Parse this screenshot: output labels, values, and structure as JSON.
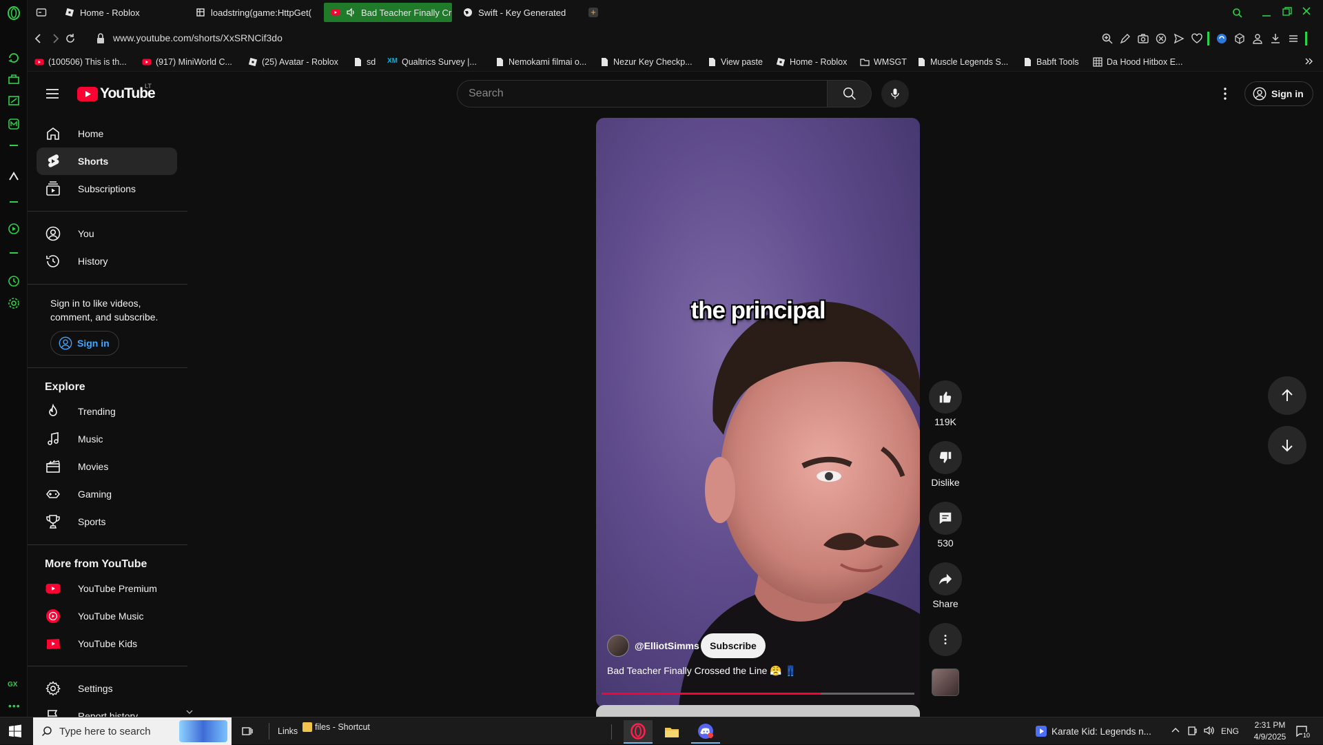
{
  "browser": {
    "tabs": [
      {
        "label": "Home - Roblox",
        "active": false
      },
      {
        "label": "loadstring(game:HttpGet(",
        "active": false
      },
      {
        "label": "Bad Teacher Finally Cr",
        "active": true
      },
      {
        "label": "Swift - Key Generated",
        "active": false
      }
    ],
    "new_tab_symbol": "+",
    "url": "www.youtube.com/shorts/XxSRNCif3do",
    "bookmarks": [
      "(100506) This is th...",
      "(917) MiniWorld C...",
      "(25) Avatar - Roblox",
      "sd",
      "Qualtrics Survey |...",
      "Nemokami filmai o...",
      "Nezur Key Checkp...",
      "View paste",
      "Home - Roblox",
      "WMSGT",
      "Muscle Legends S...",
      "Babft Tools",
      "Da Hood Hitbox E..."
    ],
    "bookmark_qualtrics_badge": "XM",
    "gx_label": "GX",
    "accent_color": "#2bd24a"
  },
  "youtube": {
    "logo_text": "YouTube",
    "country_code": "LT",
    "search_placeholder": "Search",
    "sign_in_label": "Sign in",
    "sidebar": {
      "primary": [
        {
          "label": "Home",
          "icon": "home-icon",
          "active": false
        },
        {
          "label": "Shorts",
          "icon": "shorts-icon",
          "active": true
        },
        {
          "label": "Subscriptions",
          "icon": "subscriptions-icon",
          "active": false
        }
      ],
      "you": [
        {
          "label": "You",
          "icon": "you-icon"
        },
        {
          "label": "History",
          "icon": "history-icon"
        }
      ],
      "signin_prompt": "Sign in to like videos, comment, and subscribe.",
      "explore_heading": "Explore",
      "explore": [
        {
          "label": "Trending",
          "icon": "trending-icon"
        },
        {
          "label": "Music",
          "icon": "music-icon"
        },
        {
          "label": "Movies",
          "icon": "movies-icon"
        },
        {
          "label": "Gaming",
          "icon": "gaming-icon"
        },
        {
          "label": "Sports",
          "icon": "sports-icon"
        }
      ],
      "more_heading": "More from YouTube",
      "more": [
        {
          "label": "YouTube Premium",
          "icon": "youtube-premium-icon"
        },
        {
          "label": "YouTube Music",
          "icon": "youtube-music-icon"
        },
        {
          "label": "YouTube Kids",
          "icon": "youtube-kids-icon"
        }
      ],
      "settings_label": "Settings",
      "report_label": "Report history"
    },
    "short": {
      "caption": "the principal",
      "channel": "@ElliotSimms",
      "subscribe_label": "Subscribe",
      "title": "Bad Teacher Finally Crossed the Line 😤 👖",
      "progress_percent": 70
    },
    "actions": {
      "like_count": "119K",
      "dislike_label": "Dislike",
      "comment_count": "530",
      "share_label": "Share"
    },
    "brand_color": "#ff0033",
    "link_color": "#3ea6ff"
  },
  "taskbar": {
    "search_placeholder": "Type here to search",
    "links_label": "Links",
    "files_label": "files - Shortcut",
    "media_label": "Karate Kid: Legends n...",
    "language": "ENG",
    "time": "2:31 PM",
    "date": "4/9/2025",
    "notification_count": "10"
  }
}
